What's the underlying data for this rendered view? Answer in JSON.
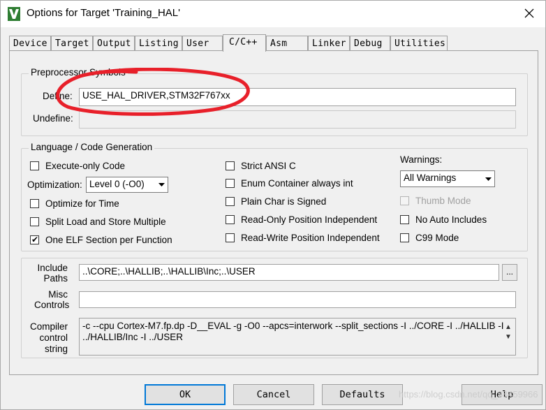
{
  "window": {
    "title": "Options for Target 'Training_HAL'"
  },
  "icons": {
    "app": "keil-uvision-icon",
    "close": "close-icon"
  },
  "tabs": [
    {
      "label": "Device"
    },
    {
      "label": "Target"
    },
    {
      "label": "Output"
    },
    {
      "label": "Listing"
    },
    {
      "label": "User"
    },
    {
      "label": "C/C++",
      "active": true
    },
    {
      "label": "Asm"
    },
    {
      "label": "Linker"
    },
    {
      "label": "Debug"
    },
    {
      "label": "Utilities"
    }
  ],
  "preprocessor": {
    "group_label": "Preprocessor Symbols",
    "define_label": "Define:",
    "define_value": "USE_HAL_DRIVER,STM32F767xx",
    "undefine_label": "Undefine:",
    "undefine_value": ""
  },
  "codegen": {
    "group_label": "Language / Code Generation",
    "execute_only": {
      "label": "Execute-only Code",
      "checked": false
    },
    "optimization_label": "Optimization:",
    "optimization_value": "Level 0 (-O0)",
    "optimize_time": {
      "label": "Optimize for Time",
      "checked": false
    },
    "split_load_store": {
      "label": "Split Load and Store Multiple",
      "checked": false
    },
    "one_elf": {
      "label": "One ELF Section per Function",
      "checked": true
    },
    "strict_ansi": {
      "label": "Strict ANSI C",
      "checked": false
    },
    "enum_container": {
      "label": "Enum Container always int",
      "checked": false
    },
    "plain_char": {
      "label": "Plain Char is Signed",
      "checked": false
    },
    "ro_position": {
      "label": "Read-Only Position Independent",
      "checked": false
    },
    "rw_position": {
      "label": "Read-Write Position Independent",
      "checked": false
    },
    "warnings_label": "Warnings:",
    "warnings_value": "All Warnings",
    "thumb_mode": {
      "label": "Thumb Mode",
      "checked": false,
      "disabled": true
    },
    "no_auto_includes": {
      "label": "No Auto Includes",
      "checked": false
    },
    "c99_mode": {
      "label": "C99 Mode",
      "checked": false
    }
  },
  "include_paths": {
    "label_line1": "Include",
    "label_line2": "Paths",
    "value": "..\\CORE;..\\HALLIB;..\\HALLIB\\Inc;..\\USER",
    "browse_label": "..."
  },
  "misc_controls": {
    "label_line1": "Misc",
    "label_line2": "Controls",
    "value": ""
  },
  "compiler_control": {
    "label_line1": "Compiler",
    "label_line2": "control",
    "label_line3": "string",
    "line1": "-c --cpu Cortex-M7.fp.dp -D__EVAL -g -O0 --apcs=interwork --split_sections -I ../CORE -I ../HALLIB -I",
    "line2": "../HALLIB/Inc -I ../USER"
  },
  "buttons": {
    "ok": "OK",
    "cancel": "Cancel",
    "defaults": "Defaults",
    "help": "Help"
  },
  "watermark": "https://blog.csdn.net/qq_38459966",
  "colors": {
    "annotation_red": "#e8202a",
    "focus_blue": "#0078d7"
  }
}
